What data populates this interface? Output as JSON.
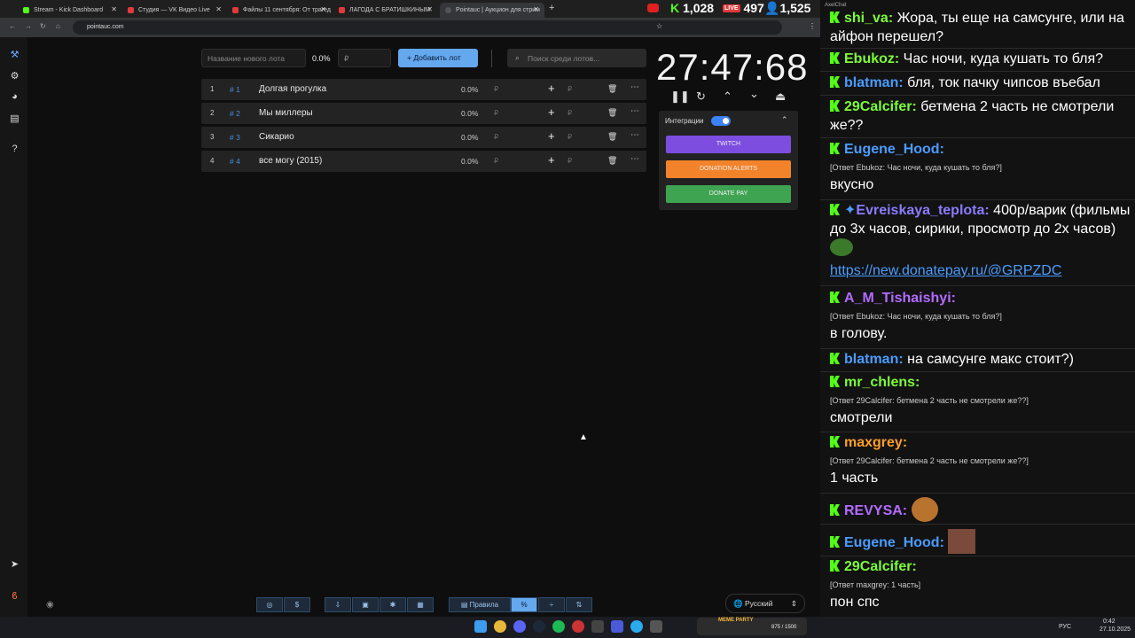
{
  "browser": {
    "tabs": [
      {
        "label": "Stream - Kick Dashboard",
        "color": "#53fc18"
      },
      {
        "label": "Студия — VK Видео Live",
        "color": "#e03a3a"
      },
      {
        "label": "Файлы 11 сентября: От трагед",
        "color": "#e03a3a"
      },
      {
        "label": "ЛАГОДА С БРАТИШКИНЫМ",
        "color": "#e03a3a"
      },
      {
        "label": "Pointauc | Аукцион для стрим",
        "color": "#333"
      }
    ],
    "url": "pointauc.com",
    "stats": {
      "kick": "1,028",
      "vk": "497",
      "viewers": "1,525"
    }
  },
  "form": {
    "name_placeholder": "Название нового лота",
    "percent": "0.0%",
    "amount_placeholder": "₽",
    "add_label": "Добавить лот",
    "search_placeholder": "Поиск среди лотов..."
  },
  "lots": [
    {
      "n": "1",
      "id": "# 1",
      "title": "Долгая прогулка",
      "pct": "0.0%"
    },
    {
      "n": "2",
      "id": "# 2",
      "title": "Мы миллеры",
      "pct": "0.0%"
    },
    {
      "n": "3",
      "id": "# 3",
      "title": "Сикарио",
      "pct": "0.0%"
    },
    {
      "n": "4",
      "id": "# 4",
      "title": "все могу (2015)",
      "pct": "0.0%"
    }
  ],
  "currency": "₽",
  "timer": "27:47:68",
  "integrations": {
    "label": "Интеграции",
    "twitch": "TWITCH",
    "donation_alerts": "DONATION ALERTS",
    "donatepay": "DONATE PAY"
  },
  "bottom": {
    "rules": "Правила",
    "language": "Русский"
  },
  "chat": {
    "title": "AxelChat",
    "messages": [
      {
        "user": "shi_va",
        "color": "#7cfc3a",
        "text": "Жора, ты еще на самсунге, или на айфон перешел?"
      },
      {
        "user": "Ebukoz",
        "color": "#7cfc3a",
        "text": "Час ночи, куда кушать то бля?"
      },
      {
        "user": "blatman",
        "color": "#4a9cff",
        "text": "бля, ток пачку чипсов въебал"
      },
      {
        "user": "29Calcifer",
        "color": "#7cfc3a",
        "text": "бетмена 2 часть не смотрели же??"
      },
      {
        "user": "Eugene_Hood",
        "color": "#4a9cff",
        "reply": "[Ответ Ebukoz: Час ночи, куда кушать то бля?]",
        "text": "вкусно"
      },
      {
        "user": "Evreiskaya_teplota",
        "color": "#8a7cff",
        "text": "400р/варик (фильмы до 3х часов, сирики, просмотр до 2х часов)",
        "link": "https://new.donatepay.ru/@GRPZDC"
      },
      {
        "user": "A_M_Tishaishyi",
        "color": "#b36bff",
        "reply": "[Ответ Ebukoz: Час ночи, куда кушать то бля?]",
        "text": "в голову."
      },
      {
        "user": "blatman",
        "color": "#4a9cff",
        "text": "на самсунге макс стоит?)"
      },
      {
        "user": "mr_chlens",
        "color": "#7cfc3a",
        "reply": "[Ответ 29Calcifer: бетмена 2 часть не смотрели же??]",
        "text": "смотрели"
      },
      {
        "user": "maxgrey",
        "color": "#ff9f2a",
        "reply": "[Ответ 29Calcifer: бетмена 2 часть не смотрели же??]",
        "text": "1 часть"
      },
      {
        "user": "REVYSA",
        "color": "#b36bff",
        "text": ""
      },
      {
        "user": "Eugene_Hood",
        "color": "#4a9cff",
        "text": ""
      },
      {
        "user": "29Calcifer",
        "color": "#7cfc3a",
        "reply": "[Ответ maxgrey: 1 часть]",
        "text": "пон спс"
      }
    ]
  },
  "taskbar": {
    "lang": "РУС",
    "time": "0:42",
    "date": "27.10.2025",
    "meme": "MEME PARTY",
    "meme_count": "875 / 1500"
  }
}
